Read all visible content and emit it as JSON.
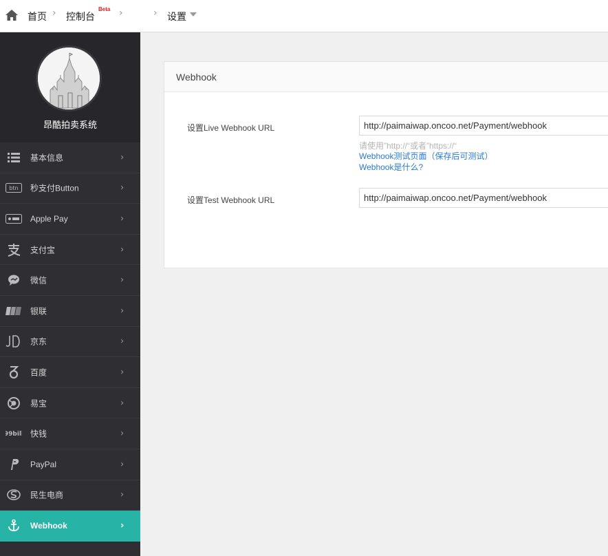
{
  "breadcrumb": {
    "home": "首页",
    "console": "控制台",
    "beta": "Beta",
    "current": "设置"
  },
  "profile": {
    "name": "昂酷拍卖系统"
  },
  "nav": {
    "items": [
      {
        "label": "基本信息",
        "icon": "list-icon"
      },
      {
        "label": "秒支付Button",
        "icon": "btn-icon"
      },
      {
        "label": "Apple Pay",
        "icon": "apple-pay-icon"
      },
      {
        "label": "支付宝",
        "icon": "alipay-icon"
      },
      {
        "label": "微信",
        "icon": "wechat-icon"
      },
      {
        "label": "银联",
        "icon": "unionpay-icon"
      },
      {
        "label": "京东",
        "icon": "jd-icon"
      },
      {
        "label": "百度",
        "icon": "baidu-icon"
      },
      {
        "label": "易宝",
        "icon": "yeepay-icon"
      },
      {
        "label": "快钱",
        "icon": "99bill-icon"
      },
      {
        "label": "PayPal",
        "icon": "paypal-icon"
      },
      {
        "label": "民生电商",
        "icon": "minsheng-icon"
      },
      {
        "label": "Webhook",
        "icon": "anchor-icon",
        "active": true
      }
    ]
  },
  "card": {
    "title": "Webhook",
    "live_label": "设置Live Webhook URL",
    "live_value": "http://paimaiwap.oncoo.net/Payment/webhook",
    "hint": "请使用”http://“或者”https://“",
    "test_page_link": "Webhook测试页面（保存后可测试）",
    "what_is_link": "Webhook是什么?",
    "test_label": "设置Test Webhook URL",
    "test_value": "http://paimaiwap.oncoo.net/Payment/webhook"
  },
  "colors": {
    "sidebar_bg": "#2e2e33",
    "active_accent": "#27b3a6",
    "link": "#2a7ad6"
  }
}
